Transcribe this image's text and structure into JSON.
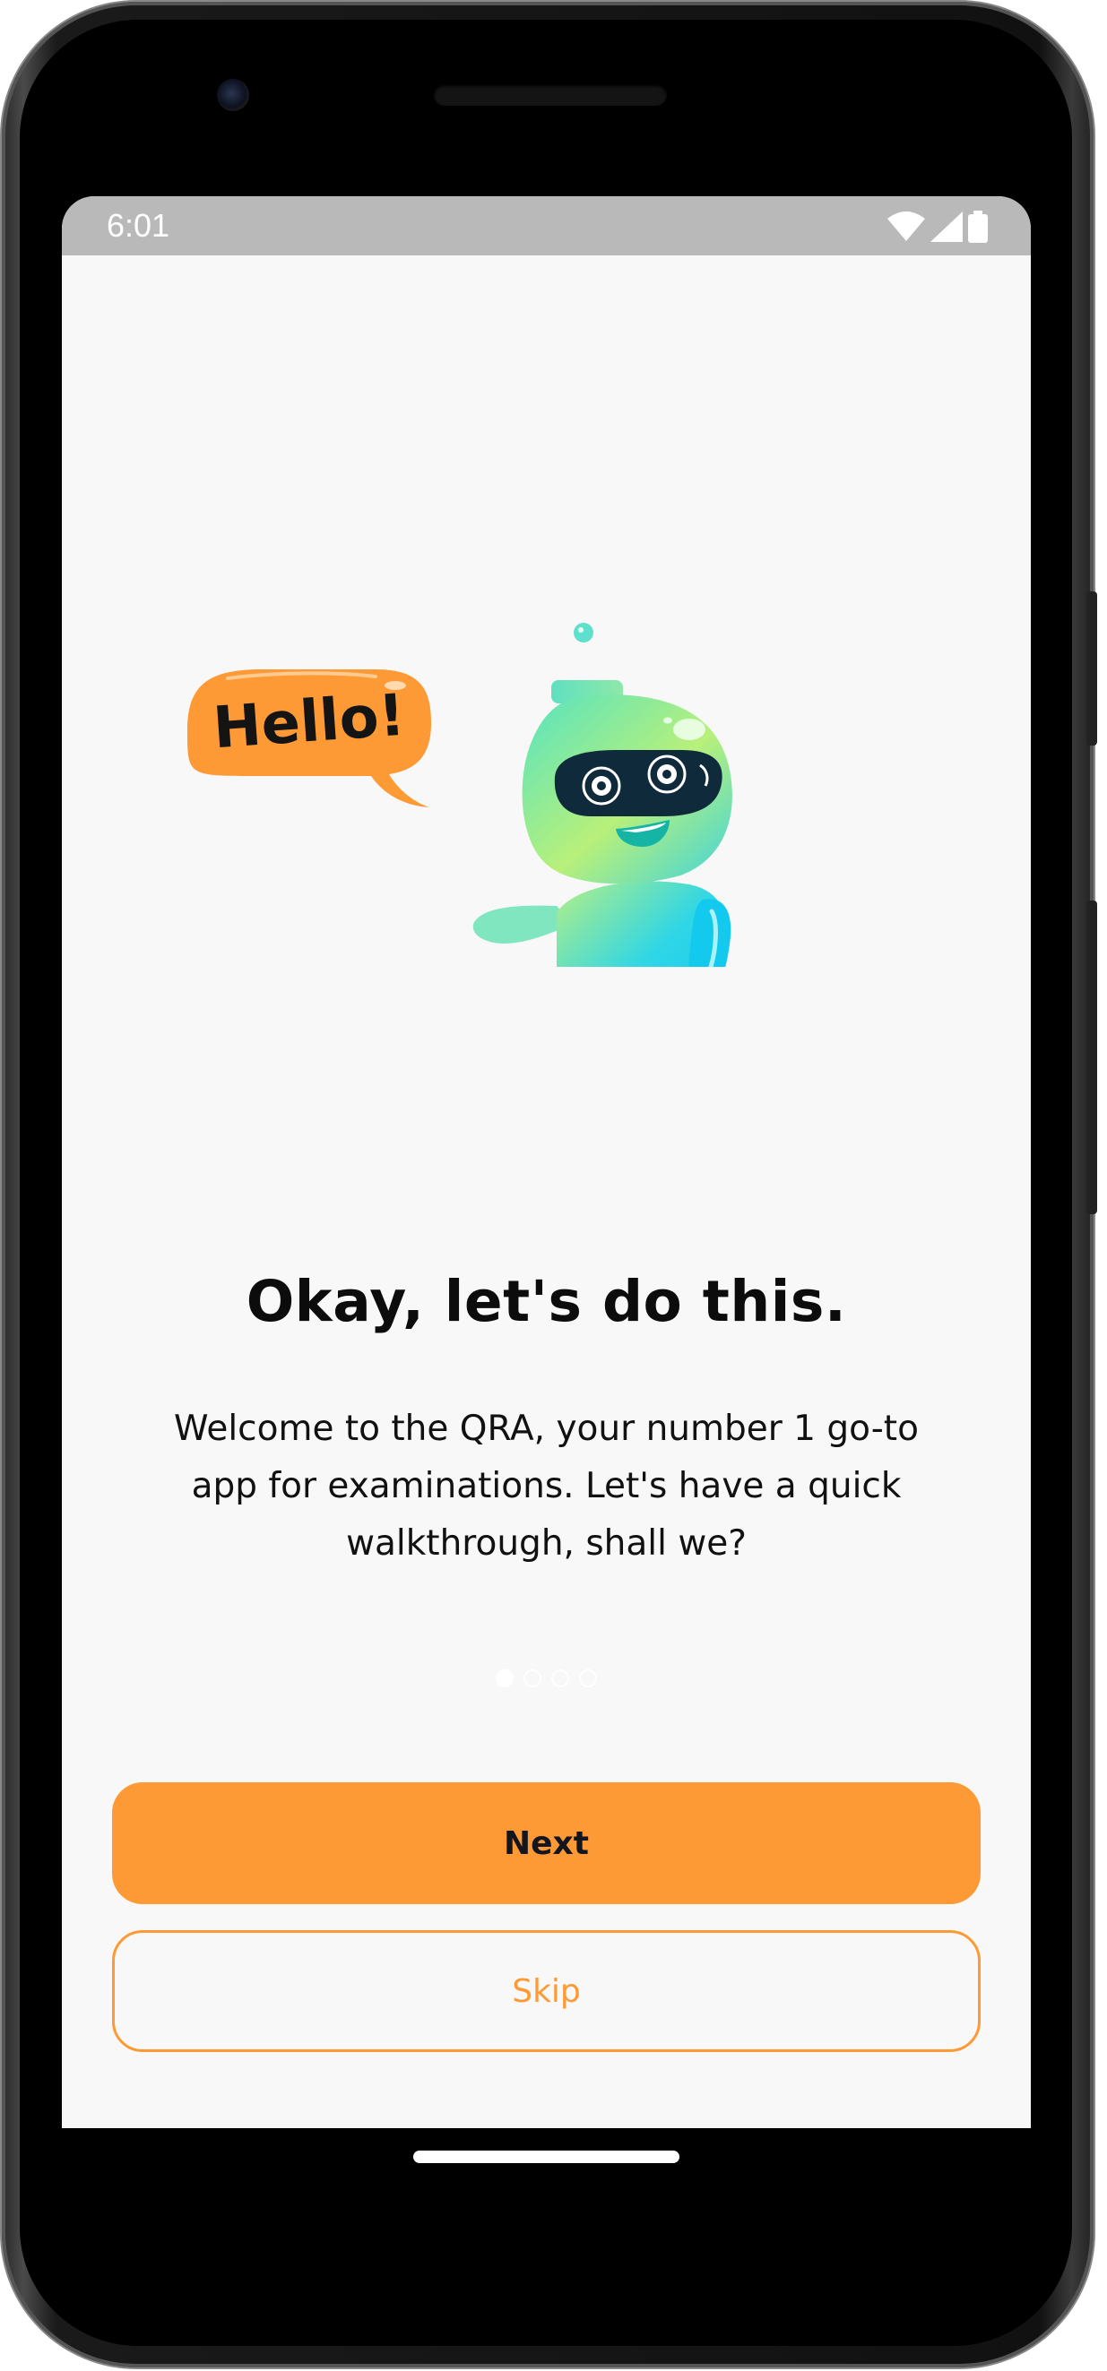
{
  "status_bar": {
    "time": "6:01",
    "icons": [
      "wifi-icon",
      "cellular-signal-icon",
      "battery-icon"
    ]
  },
  "illustration": {
    "speech_bubble_text": "Hello!",
    "bubble_color": "#FD9A36"
  },
  "onboarding": {
    "title": "Okay, let's do this.",
    "line_1": "Welcome to the QRA, your number 1 go-to",
    "line_2": "app for examinations. Let's have a quick",
    "line_3": "walkthrough, shall we?",
    "page_indicator": {
      "total": 4,
      "active_index": 0
    }
  },
  "actions": {
    "next_label": "Next",
    "skip_label": "Skip"
  },
  "colors": {
    "accent": "#FD9A36",
    "background": "#F8F8F8",
    "status_bar": "#B9B9B9"
  }
}
